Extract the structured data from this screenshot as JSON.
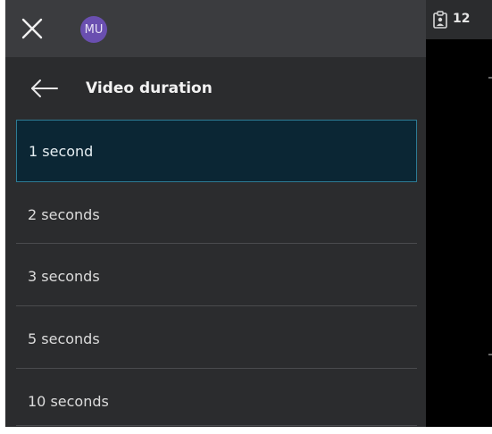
{
  "topbar": {
    "close_icon": "close-icon",
    "avatar_initials": "MU",
    "avatar_color": "#6a4fb0"
  },
  "header": {
    "back_icon": "arrow-left-icon",
    "title": "Video duration"
  },
  "options": [
    {
      "label": "1 second",
      "selected": true
    },
    {
      "label": "2 seconds",
      "selected": false
    },
    {
      "label": "3 seconds",
      "selected": false
    },
    {
      "label": "5 seconds",
      "selected": false
    },
    {
      "label": "10 seconds",
      "selected": false
    }
  ],
  "right": {
    "clipboard_icon": "clipboard-person-icon",
    "count": "12"
  },
  "colors": {
    "panel_bg": "#2b2c2e",
    "topbar_bg": "#3b3c3f",
    "selected_bg": "#0b2634",
    "selected_border": "#2d7b95"
  }
}
